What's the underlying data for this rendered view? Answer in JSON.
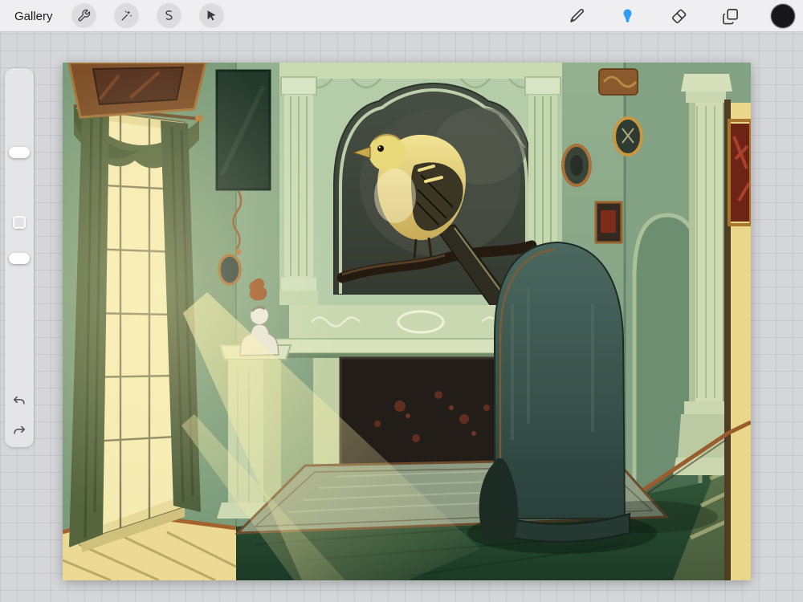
{
  "topbar": {
    "gallery_label": "Gallery",
    "left_tools": [
      {
        "name": "actions",
        "icon": "wrench-icon"
      },
      {
        "name": "adjustments",
        "icon": "magic-wand-icon"
      },
      {
        "name": "selection",
        "icon": "selection-s-icon"
      },
      {
        "name": "transform",
        "icon": "transform-arrow-icon"
      }
    ],
    "right_tools": [
      {
        "name": "paint",
        "icon": "brush-icon",
        "active": false
      },
      {
        "name": "smudge",
        "icon": "smudge-icon",
        "active": true
      },
      {
        "name": "erase",
        "icon": "eraser-icon",
        "active": false
      },
      {
        "name": "layers",
        "icon": "layers-icon",
        "active": false
      },
      {
        "name": "color",
        "icon": "color-swatch",
        "active": false
      }
    ],
    "active_tool": "smudge",
    "accent_color": "#2f9df6",
    "current_color": "#17171b",
    "swatch_style": "background:#17171b"
  },
  "sidebar": {
    "controls": [
      "brush-size-slider",
      "modify-button",
      "opacity-slider",
      "undo-button",
      "redo-button"
    ]
  },
  "canvas": {
    "description": "Digital painting of a green Victorian room: goldfinch portrait in an arched overmantel above a fireplace, dark wingback chair, sunlit window with olive curtains at left, marble bust on a pedestal, framed pictures, and a columned hallway at right.",
    "palette": {
      "wall_green": "#87a386",
      "light_warm": "#f0e2a0",
      "curtain_olive": "#5a6b42",
      "chair_teal": "#3c5650",
      "floor_green": "#2e5434",
      "accent_bronze": "#9a6a34"
    }
  }
}
